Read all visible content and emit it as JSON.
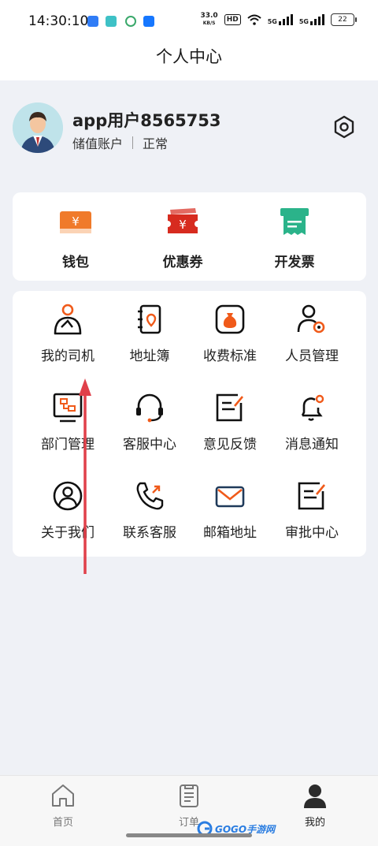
{
  "status_bar": {
    "time": "14:30:10",
    "speed_value": "33.0",
    "speed_unit": "KB/S",
    "hd_label": "HD",
    "net1": "5G",
    "net2": "5G",
    "battery": "22",
    "app_icons": [
      "feishu-icon",
      "boss-zhipin-icon",
      "mobile-icon",
      "alipay-icon"
    ]
  },
  "header": {
    "title": "个人中心"
  },
  "profile": {
    "username": "app用户8565753",
    "account_type": "储值账户",
    "account_status": "正常"
  },
  "wallet": {
    "items": [
      {
        "label": "钱包",
        "icon": "wallet-icon",
        "color": "#f07a2a"
      },
      {
        "label": "优惠券",
        "icon": "coupon-icon",
        "color": "#d72b1f"
      },
      {
        "label": "开发票",
        "icon": "invoice-icon",
        "color": "#2bb38a"
      }
    ]
  },
  "services": {
    "items": [
      {
        "label": "我的司机",
        "icon": "driver-icon"
      },
      {
        "label": "地址簿",
        "icon": "address-book-icon"
      },
      {
        "label": "收费标准",
        "icon": "fee-standard-icon"
      },
      {
        "label": "人员管理",
        "icon": "staff-management-icon"
      },
      {
        "label": "部门管理",
        "icon": "department-icon"
      },
      {
        "label": "客服中心",
        "icon": "headset-icon"
      },
      {
        "label": "意见反馈",
        "icon": "feedback-icon"
      },
      {
        "label": "消息通知",
        "icon": "bell-icon"
      },
      {
        "label": "关于我们",
        "icon": "about-us-icon"
      },
      {
        "label": "联系客服",
        "icon": "phone-icon"
      },
      {
        "label": "邮箱地址",
        "icon": "mail-icon"
      },
      {
        "label": "审批中心",
        "icon": "approval-icon"
      }
    ]
  },
  "tab_bar": {
    "items": [
      {
        "label": "首页",
        "icon": "home-icon",
        "active": false
      },
      {
        "label": "订单",
        "icon": "order-icon",
        "active": false
      },
      {
        "label": "我的",
        "icon": "profile-icon",
        "active": true
      }
    ]
  },
  "watermark": {
    "text": "GOGO手游网"
  },
  "colors": {
    "accent": "#f05a1a",
    "arrow": "#e0404a",
    "background": "#eff1f6"
  }
}
